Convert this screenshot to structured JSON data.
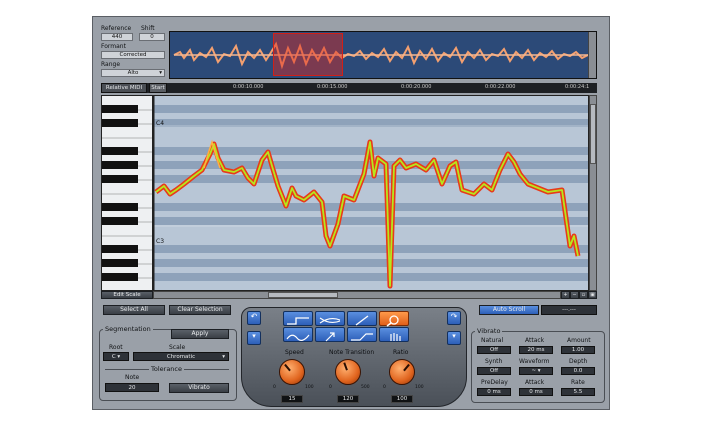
{
  "reference": {
    "label": "Reference",
    "value": "440"
  },
  "shift": {
    "label": "Shift",
    "value": "0"
  },
  "formant": {
    "label": "Formant",
    "value": "Corrected"
  },
  "range": {
    "label": "Range",
    "value": "Alto"
  },
  "ruler": {
    "header_left": "Relative MIDI",
    "header_right": "Start",
    "ticks": [
      "0:00:10.000",
      "0:00:15.000",
      "0:00:20.000",
      "0:00:22.000",
      "0:00:24:1"
    ]
  },
  "note_labels": {
    "c4": "C4",
    "c3": "C3"
  },
  "edit_scale": "Edit Scale",
  "buttons": {
    "select_all": "Select All",
    "clear_selection": "Clear Selection",
    "auto_scroll": "Auto Scroll",
    "auto_scroll_value": "---.---"
  },
  "segmentation": {
    "title": "Segmentation",
    "apply": "Apply",
    "root_label": "Root",
    "root_value": "C",
    "scale_label": "Scale",
    "scale_value": "Chromatic",
    "tolerance_label": "Tolerance",
    "note_label": "Note",
    "note_value": "20",
    "vibrato_btn": "Vibrato"
  },
  "controls": {
    "speed": {
      "label": "Speed",
      "value": "15",
      "min": "0",
      "max": "100"
    },
    "note_transition": {
      "label": "Note Transition",
      "value": "120",
      "min": "0",
      "max": "500"
    },
    "ratio": {
      "label": "Ratio",
      "value": "100",
      "min": "0",
      "max": "100"
    }
  },
  "vibrato": {
    "title": "Vibrato",
    "natural_label": "Natural",
    "natural_value": "Off",
    "attack_label": "Attack",
    "attack_value": "20 ms",
    "amount_label": "Amount",
    "amount_value": "1.00",
    "synth_label": "Synth",
    "synth_value": "Off",
    "waveform_label": "Waveform",
    "waveform_value": "~",
    "depth_label": "Depth",
    "depth_value": "0.0",
    "predelay_label": "PreDelay",
    "predelay_value": "0 ms",
    "attack2_label": "Attack",
    "attack2_value": "0 ms",
    "rate_label": "Rate",
    "rate_value": "5.5"
  },
  "colors": {
    "accent": "#e0601a",
    "tool_blue": "#2d5fb8",
    "pitch_green": "#b6e81c",
    "pitch_red": "#e83a1a"
  }
}
